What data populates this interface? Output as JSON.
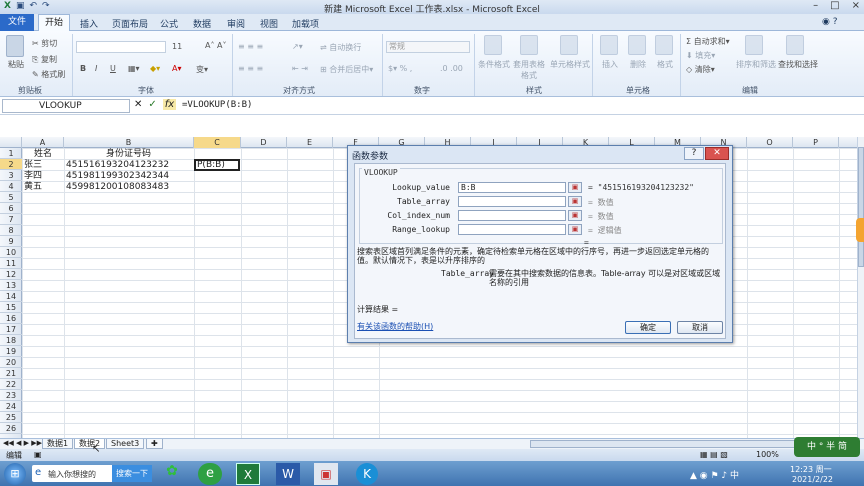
{
  "window": {
    "title": "新建 Microsoft Excel 工作表.xlsx - Microsoft Excel",
    "controls": [
      "–",
      "□",
      "×"
    ]
  },
  "ribbon": {
    "tabs": [
      "文件",
      "开始",
      "插入",
      "页面布局",
      "公式",
      "数据",
      "审阅",
      "视图",
      "加载项"
    ],
    "clipboard": {
      "paste": "粘贴",
      "cut": "剪切",
      "copy": "复制",
      "format_painter": "格式刷",
      "label": "剪贴板"
    },
    "font": {
      "size": "11",
      "bold": "B",
      "italic": "I",
      "underline": "U",
      "label": "字体"
    },
    "alignment": {
      "wrap": "自动换行",
      "merge": "合并后居中",
      "label": "对齐方式"
    },
    "number": {
      "format": "常规",
      "label": "数字"
    },
    "styles": {
      "conditional": "条件格式",
      "table": "套用表格格式",
      "cell": "单元格样式",
      "label": "样式"
    },
    "cells": {
      "insert": "插入",
      "delete": "删除",
      "format": "格式",
      "label": "单元格"
    },
    "editing": {
      "autosum": "自动求和",
      "fill": "填充",
      "clear": "清除",
      "sort": "排序和筛选",
      "find": "查找和选择",
      "label": "编辑"
    }
  },
  "formula_bar": {
    "name_box": "VLOOKUP",
    "formula": "=VLOOKUP(B:B)"
  },
  "sheet": {
    "columns": [
      "A",
      "B",
      "C",
      "D",
      "E",
      "F",
      "G",
      "H",
      "I",
      "J",
      "K",
      "L",
      "M",
      "N",
      "O",
      "P"
    ],
    "rows": [
      "1",
      "2",
      "3",
      "4",
      "5",
      "6",
      "7",
      "8",
      "9",
      "10",
      "11",
      "12",
      "13",
      "14",
      "15",
      "16",
      "17",
      "18",
      "19",
      "20",
      "21",
      "22",
      "23",
      "24",
      "25",
      "26"
    ],
    "cells": {
      "A1": "姓名",
      "B1": "身份证号码",
      "A2": "张三",
      "B2": "451516193204123232",
      "A3": "李四",
      "B3": "451981199302342344",
      "A4": "黄五",
      "B4": "459981200108083483",
      "C2": "P(B:B)"
    },
    "tabs": [
      "数据1",
      "数据2",
      "Sheet3"
    ]
  },
  "dialog": {
    "title": "函数参数",
    "function": "VLOOKUP",
    "args": [
      {
        "name": "Lookup_value",
        "value": "B:B",
        "result": "= \"451516193204123232\""
      },
      {
        "name": "Table_array",
        "value": "",
        "result": "= 数值"
      },
      {
        "name": "Col_index_num",
        "value": "",
        "result": "= 数值"
      },
      {
        "name": "Range_lookup",
        "value": "",
        "result": "= 逻辑值"
      }
    ],
    "eq": "=",
    "description": "搜索表区域首列满足条件的元素，确定待检索单元格在区域中的行序号，再进一步返回选定单元格的值。默认情况下，表是以升序排序的",
    "arg_desc_name": "Table_array",
    "arg_desc": "需要在其中搜索数据的信息表。Table-array 可以是对区域或区域名称的引用",
    "result_label": "计算结果 =",
    "help_link": "有关该函数的帮助(H)",
    "ok": "确定",
    "cancel": "取消"
  },
  "status": {
    "mode": "编辑",
    "zoom": "100%"
  },
  "taskbar": {
    "search_placeholder": "输入你想搜的",
    "search_button": "搜索一下",
    "time": "12:23 周一",
    "date": "2021/2/22",
    "ime": "中 ° 半 简"
  }
}
